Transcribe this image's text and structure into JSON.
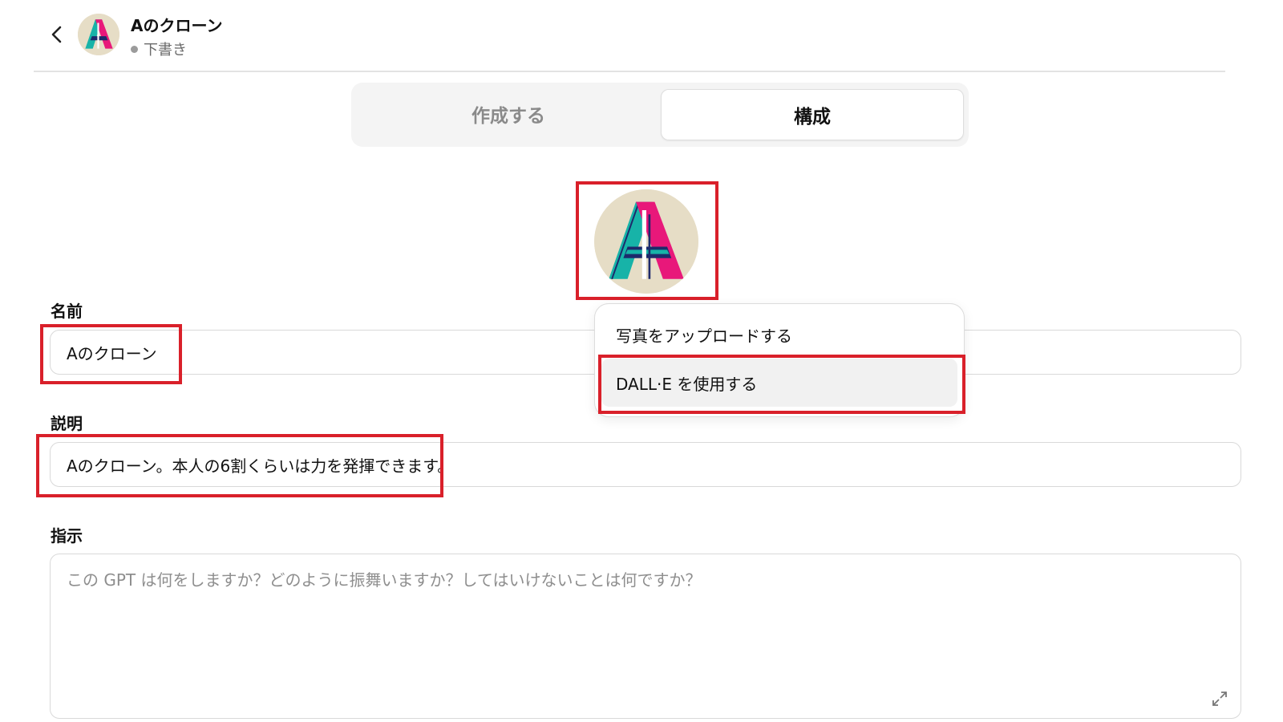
{
  "header": {
    "back_label": "‹",
    "title": "Aのクローン",
    "status": "下書き"
  },
  "tabs": [
    {
      "label": "作成する",
      "active": false
    },
    {
      "label": "構成",
      "active": true
    }
  ],
  "fields": {
    "name": {
      "label": "名前",
      "value": "Aのクローン"
    },
    "description": {
      "label": "説明",
      "value": "Aのクローン。本人の6割くらいは力を発揮できます。"
    },
    "instructions": {
      "label": "指示",
      "value": "",
      "placeholder": "この GPT は何をしますか？どのように振舞いますか？してはいけないことは何ですか？"
    }
  },
  "avatar_menu": {
    "items": [
      {
        "label": "写真をアップロードする"
      },
      {
        "label": "DALL·E を使用する"
      }
    ]
  },
  "colors": {
    "highlight": "#d9202a",
    "avatar_bg": "#e6ddc6",
    "logo_teal": "#17b3a8",
    "logo_pink": "#e8187a"
  }
}
